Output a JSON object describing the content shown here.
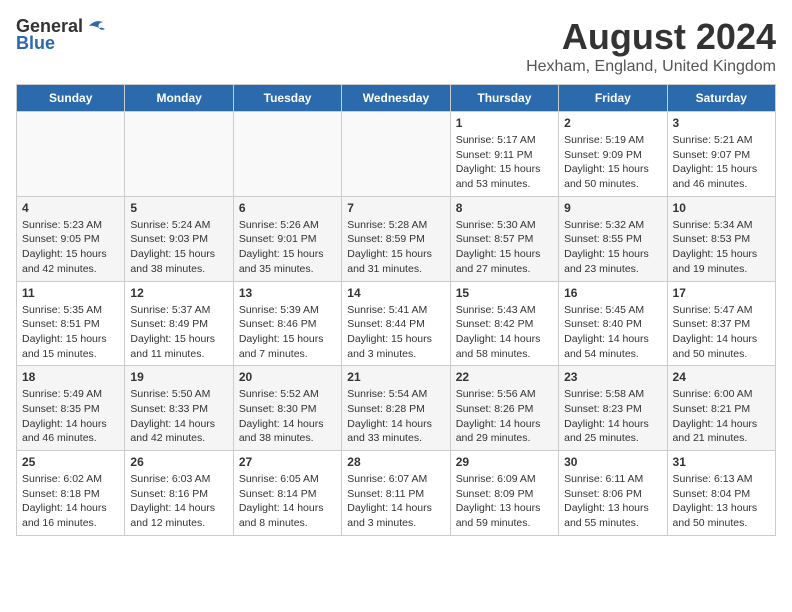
{
  "header": {
    "logo_general": "General",
    "logo_blue": "Blue",
    "month_year": "August 2024",
    "location": "Hexham, England, United Kingdom"
  },
  "days_of_week": [
    "Sunday",
    "Monday",
    "Tuesday",
    "Wednesday",
    "Thursday",
    "Friday",
    "Saturday"
  ],
  "weeks": [
    [
      {
        "day": "",
        "info": ""
      },
      {
        "day": "",
        "info": ""
      },
      {
        "day": "",
        "info": ""
      },
      {
        "day": "",
        "info": ""
      },
      {
        "day": "1",
        "info": "Sunrise: 5:17 AM\nSunset: 9:11 PM\nDaylight: 15 hours\nand 53 minutes."
      },
      {
        "day": "2",
        "info": "Sunrise: 5:19 AM\nSunset: 9:09 PM\nDaylight: 15 hours\nand 50 minutes."
      },
      {
        "day": "3",
        "info": "Sunrise: 5:21 AM\nSunset: 9:07 PM\nDaylight: 15 hours\nand 46 minutes."
      }
    ],
    [
      {
        "day": "4",
        "info": "Sunrise: 5:23 AM\nSunset: 9:05 PM\nDaylight: 15 hours\nand 42 minutes."
      },
      {
        "day": "5",
        "info": "Sunrise: 5:24 AM\nSunset: 9:03 PM\nDaylight: 15 hours\nand 38 minutes."
      },
      {
        "day": "6",
        "info": "Sunrise: 5:26 AM\nSunset: 9:01 PM\nDaylight: 15 hours\nand 35 minutes."
      },
      {
        "day": "7",
        "info": "Sunrise: 5:28 AM\nSunset: 8:59 PM\nDaylight: 15 hours\nand 31 minutes."
      },
      {
        "day": "8",
        "info": "Sunrise: 5:30 AM\nSunset: 8:57 PM\nDaylight: 15 hours\nand 27 minutes."
      },
      {
        "day": "9",
        "info": "Sunrise: 5:32 AM\nSunset: 8:55 PM\nDaylight: 15 hours\nand 23 minutes."
      },
      {
        "day": "10",
        "info": "Sunrise: 5:34 AM\nSunset: 8:53 PM\nDaylight: 15 hours\nand 19 minutes."
      }
    ],
    [
      {
        "day": "11",
        "info": "Sunrise: 5:35 AM\nSunset: 8:51 PM\nDaylight: 15 hours\nand 15 minutes."
      },
      {
        "day": "12",
        "info": "Sunrise: 5:37 AM\nSunset: 8:49 PM\nDaylight: 15 hours\nand 11 minutes."
      },
      {
        "day": "13",
        "info": "Sunrise: 5:39 AM\nSunset: 8:46 PM\nDaylight: 15 hours\nand 7 minutes."
      },
      {
        "day": "14",
        "info": "Sunrise: 5:41 AM\nSunset: 8:44 PM\nDaylight: 15 hours\nand 3 minutes."
      },
      {
        "day": "15",
        "info": "Sunrise: 5:43 AM\nSunset: 8:42 PM\nDaylight: 14 hours\nand 58 minutes."
      },
      {
        "day": "16",
        "info": "Sunrise: 5:45 AM\nSunset: 8:40 PM\nDaylight: 14 hours\nand 54 minutes."
      },
      {
        "day": "17",
        "info": "Sunrise: 5:47 AM\nSunset: 8:37 PM\nDaylight: 14 hours\nand 50 minutes."
      }
    ],
    [
      {
        "day": "18",
        "info": "Sunrise: 5:49 AM\nSunset: 8:35 PM\nDaylight: 14 hours\nand 46 minutes."
      },
      {
        "day": "19",
        "info": "Sunrise: 5:50 AM\nSunset: 8:33 PM\nDaylight: 14 hours\nand 42 minutes."
      },
      {
        "day": "20",
        "info": "Sunrise: 5:52 AM\nSunset: 8:30 PM\nDaylight: 14 hours\nand 38 minutes."
      },
      {
        "day": "21",
        "info": "Sunrise: 5:54 AM\nSunset: 8:28 PM\nDaylight: 14 hours\nand 33 minutes."
      },
      {
        "day": "22",
        "info": "Sunrise: 5:56 AM\nSunset: 8:26 PM\nDaylight: 14 hours\nand 29 minutes."
      },
      {
        "day": "23",
        "info": "Sunrise: 5:58 AM\nSunset: 8:23 PM\nDaylight: 14 hours\nand 25 minutes."
      },
      {
        "day": "24",
        "info": "Sunrise: 6:00 AM\nSunset: 8:21 PM\nDaylight: 14 hours\nand 21 minutes."
      }
    ],
    [
      {
        "day": "25",
        "info": "Sunrise: 6:02 AM\nSunset: 8:18 PM\nDaylight: 14 hours\nand 16 minutes."
      },
      {
        "day": "26",
        "info": "Sunrise: 6:03 AM\nSunset: 8:16 PM\nDaylight: 14 hours\nand 12 minutes."
      },
      {
        "day": "27",
        "info": "Sunrise: 6:05 AM\nSunset: 8:14 PM\nDaylight: 14 hours\nand 8 minutes."
      },
      {
        "day": "28",
        "info": "Sunrise: 6:07 AM\nSunset: 8:11 PM\nDaylight: 14 hours\nand 3 minutes."
      },
      {
        "day": "29",
        "info": "Sunrise: 6:09 AM\nSunset: 8:09 PM\nDaylight: 13 hours\nand 59 minutes."
      },
      {
        "day": "30",
        "info": "Sunrise: 6:11 AM\nSunset: 8:06 PM\nDaylight: 13 hours\nand 55 minutes."
      },
      {
        "day": "31",
        "info": "Sunrise: 6:13 AM\nSunset: 8:04 PM\nDaylight: 13 hours\nand 50 minutes."
      }
    ]
  ]
}
